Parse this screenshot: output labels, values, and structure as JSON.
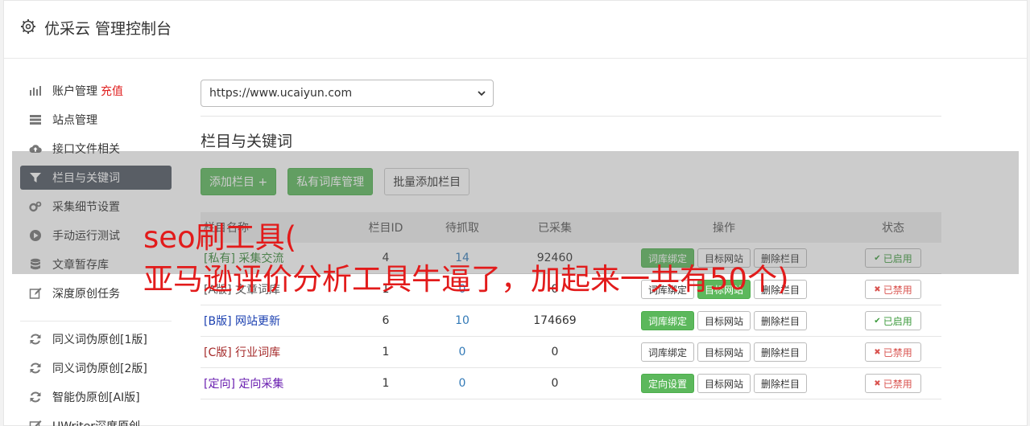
{
  "app": {
    "title": "优采云 管理控制台"
  },
  "sidebar": {
    "items": [
      {
        "label": "账户管理",
        "extra": "充值",
        "icon": "bar-chart-icon"
      },
      {
        "label": "站点管理",
        "icon": "server-icon"
      },
      {
        "label": "接口文件相关",
        "icon": "cloud-upload-icon"
      },
      {
        "label": "栏目与关键词",
        "icon": "filter-icon",
        "active": true
      },
      {
        "label": "采集细节设置",
        "icon": "cogs-icon"
      },
      {
        "label": "手动运行测试",
        "icon": "play-icon"
      },
      {
        "label": "文章暂存库",
        "icon": "database-icon"
      },
      {
        "label": "深度原创任务",
        "icon": "edit-icon"
      },
      {
        "label": "同义词伪原创[1版]",
        "icon": "refresh-icon"
      },
      {
        "label": "同义词伪原创[2版]",
        "icon": "refresh-icon"
      },
      {
        "label": "智能伪原创[AI版]",
        "icon": "refresh-icon"
      },
      {
        "label": "UWriter深度原创",
        "icon": "edit-icon"
      }
    ]
  },
  "site_select": {
    "value": "https://www.ucaiyun.com"
  },
  "section": {
    "title": "栏目与关键词"
  },
  "toolbar": {
    "add_column": "添加栏目 +",
    "private_lib": "私有词库管理",
    "batch_add": "批量添加栏目"
  },
  "table": {
    "headers": {
      "name": "栏目名称",
      "id": "栏目ID",
      "pending": "待抓取",
      "collected": "已采集",
      "ops": "操作",
      "status": "状态"
    },
    "rows": [
      {
        "name": "[私有] 采集交流",
        "name_color": "#3a8a3a",
        "id": "4",
        "pending": "14",
        "collected": "92460",
        "op1": "词库绑定",
        "op1_green": true,
        "op2": "目标网站",
        "op2_green": false,
        "op3": "删除栏目",
        "status": "已启用",
        "enabled": true
      },
      {
        "name": "[A版] 文章词库",
        "name_color": "#555555",
        "id": "1",
        "pending": "0",
        "collected": "0",
        "op1": "词库绑定",
        "op1_green": false,
        "op2": "目标网站",
        "op2_green": true,
        "op3": "删除栏目",
        "status": "已禁用",
        "enabled": false
      },
      {
        "name": "[B版] 网站更新",
        "name_color": "#1a3fb0",
        "id": "6",
        "pending": "10",
        "collected": "174669",
        "op1": "词库绑定",
        "op1_green": true,
        "op2": "目标网站",
        "op2_green": false,
        "op3": "删除栏目",
        "status": "已启用",
        "enabled": true
      },
      {
        "name": "[C版] 行业词库",
        "name_color": "#a52a2a",
        "id": "1",
        "pending": "0",
        "collected": "0",
        "op1": "词库绑定",
        "op1_green": false,
        "op2": "目标网站",
        "op2_green": false,
        "op3": "删除栏目",
        "status": "已禁用",
        "enabled": false
      },
      {
        "name": "[定向] 定向采集",
        "name_color": "#6a1fb0",
        "id": "1",
        "pending": "0",
        "collected": "0",
        "op1": "定向设置",
        "op1_green": true,
        "op2": "目标网站",
        "op2_green": false,
        "op3": "删除栏目",
        "status": "已禁用",
        "enabled": false
      }
    ]
  },
  "overlay_text": {
    "line1": "seo刷工具(",
    "line2": "亚马逊评价分析工具牛逼了，加起来一共有50个)"
  },
  "colors": {
    "accent_green": "#5cb85c",
    "active_nav": "#4f5661",
    "danger": "#d9534f",
    "overlay_text": "#e21b1b"
  }
}
